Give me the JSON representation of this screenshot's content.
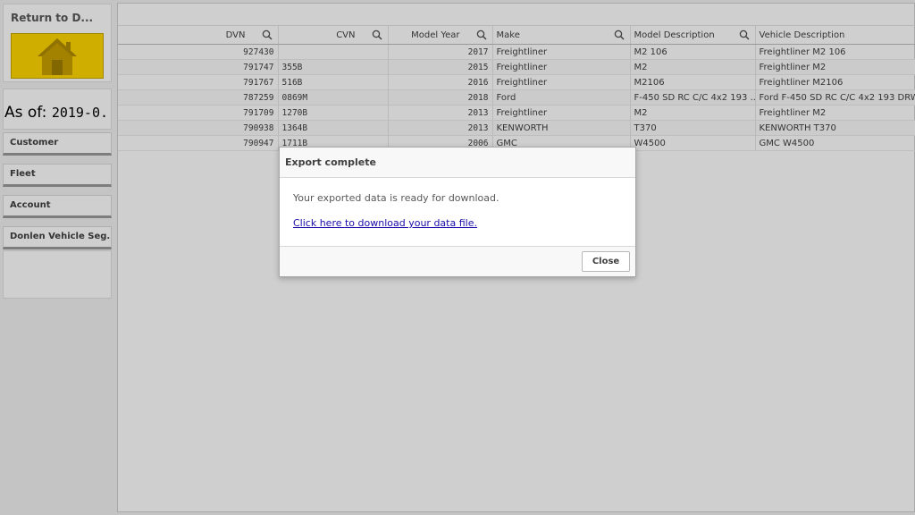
{
  "sidebar": {
    "return_label": "Return to D...",
    "as_of_prefix": "As of: ",
    "as_of_value": "2019-0...",
    "nav": [
      {
        "label": "Customer"
      },
      {
        "label": "Fleet"
      },
      {
        "label": "Account"
      },
      {
        "label": "Donlen Vehicle Seg..."
      }
    ]
  },
  "table": {
    "columns": [
      {
        "label": "DVN",
        "searchable": true
      },
      {
        "label": "CVN",
        "searchable": true
      },
      {
        "label": "Model Year",
        "searchable": true
      },
      {
        "label": "Make",
        "searchable": true
      },
      {
        "label": "Model Description",
        "searchable": true
      },
      {
        "label": "Vehicle Description",
        "searchable": false
      }
    ],
    "rows": [
      {
        "dvn": "927430",
        "cvn": "",
        "year": "2017",
        "make": "Freightliner",
        "model": "M2 106",
        "vehicle": "Freightliner M2 106"
      },
      {
        "dvn": "791747",
        "cvn": "355B",
        "year": "2015",
        "make": "Freightliner",
        "model": "M2",
        "vehicle": "Freightliner M2"
      },
      {
        "dvn": "791767",
        "cvn": "516B",
        "year": "2016",
        "make": "Freightliner",
        "model": "M2106",
        "vehicle": "Freightliner M2106"
      },
      {
        "dvn": "787259",
        "cvn": "0869M",
        "year": "2018",
        "make": "Ford",
        "model": "F-450 SD RC C/C 4x2 193 ...",
        "vehicle": "Ford F-450 SD RC C/C 4x2 193 DRW"
      },
      {
        "dvn": "791709",
        "cvn": "1270B",
        "year": "2013",
        "make": "Freightliner",
        "model": "M2",
        "vehicle": "Freightliner M2"
      },
      {
        "dvn": "790938",
        "cvn": "1364B",
        "year": "2013",
        "make": "KENWORTH",
        "model": "T370",
        "vehicle": "KENWORTH T370"
      },
      {
        "dvn": "790947",
        "cvn": "1711B",
        "year": "2006",
        "make": "GMC",
        "model": "W4500",
        "vehicle": "GMC W4500"
      }
    ]
  },
  "dialog": {
    "title": "Export complete",
    "message": "Your exported data is ready for download.",
    "link_text": "Click here to download your data file.",
    "close_label": "Close"
  },
  "colors": {
    "home_button": "#ffd700",
    "link": "#1a0dab"
  }
}
